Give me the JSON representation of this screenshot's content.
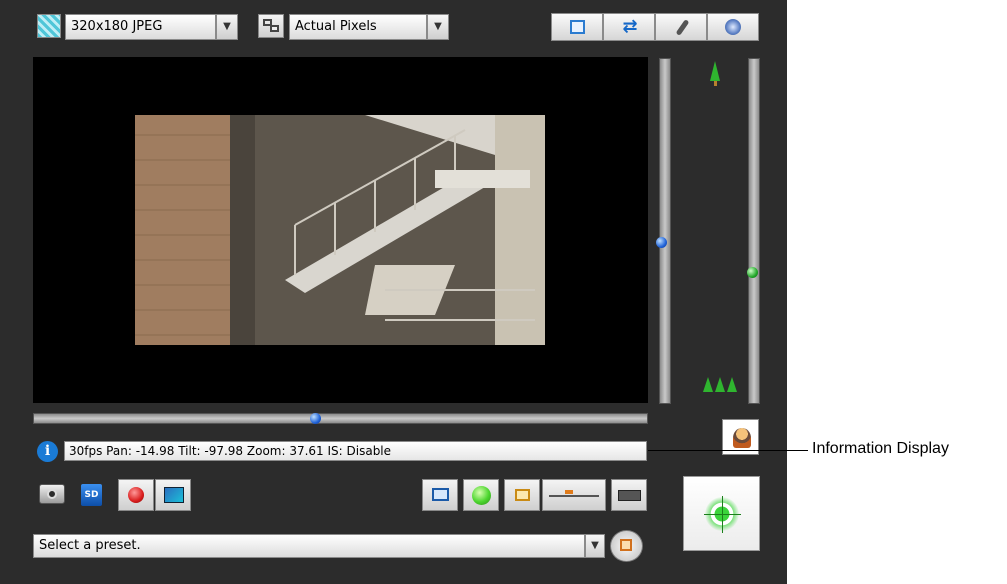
{
  "toolbar": {
    "resolution_value": "320x180 JPEG",
    "view_size_value": "Actual Pixels",
    "dropdown_arrow": "▼"
  },
  "info": {
    "text": "30fps Pan: -14.98 Tilt: -97.98 Zoom: 37.61 IS: Disable",
    "info_glyph": "i"
  },
  "controls": {
    "sd_label": "SD"
  },
  "preset": {
    "value": "Select a preset."
  },
  "callout": {
    "label": "Information Display"
  },
  "sliders": {
    "tilt_position": 0.5,
    "zoom_position": 0.68,
    "pan_position": 0.46
  },
  "icons": [
    "image-quality-icon",
    "view-size-icon",
    "fullscreen-icon",
    "swap-icon",
    "microphone-icon",
    "speaker-icon",
    "backlight-icon",
    "snapshot-icon",
    "sd-card-icon",
    "record-icon",
    "viewer-icon",
    "display-icon",
    "status-light-icon",
    "frame-icon",
    "level-icon",
    "keyboard-icon",
    "ptz-icon",
    "preset-go-icon",
    "tele-tree-icon",
    "wide-trees-icon"
  ],
  "colors": {
    "panel": "#2c2c2c",
    "video_bg": "#000000",
    "accent_blue": "#1a7bd6",
    "status_green": "#2bc82b"
  }
}
